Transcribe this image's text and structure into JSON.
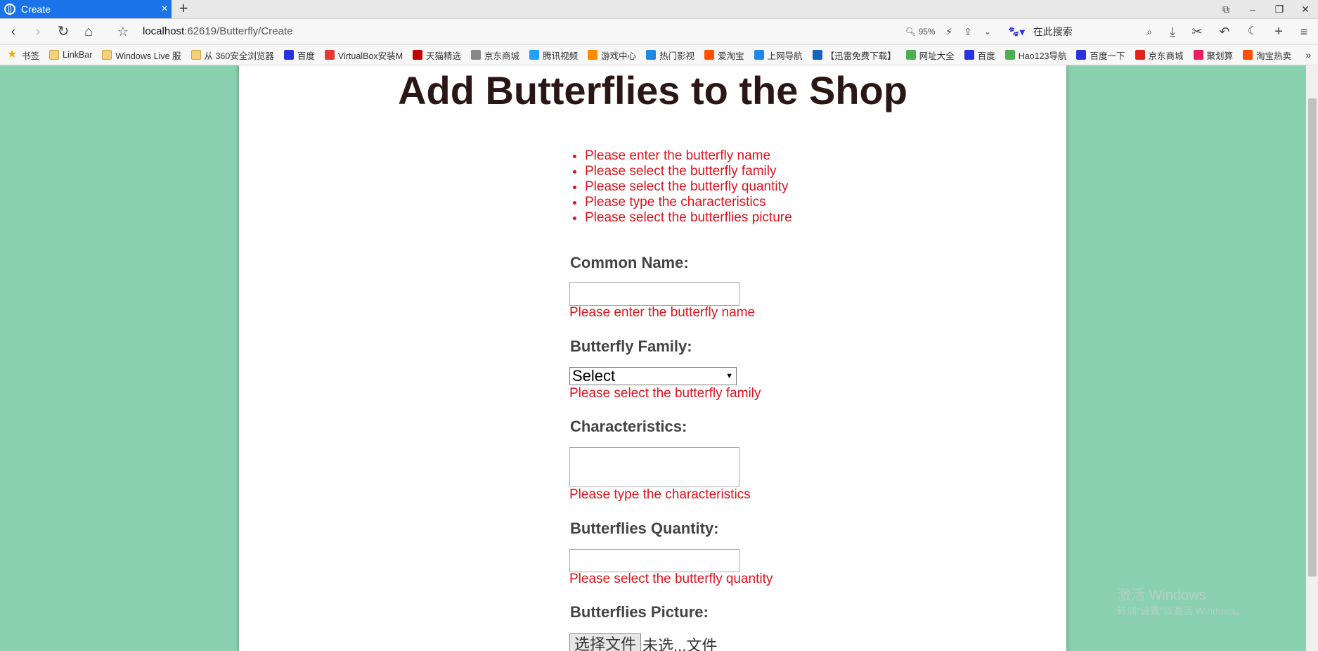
{
  "browser": {
    "tab_title": "Create",
    "url_host": "localhost",
    "url_path": ":62619/Butterfly/Create",
    "zoom": "95%",
    "search_placeholder": "在此搜索"
  },
  "bookmarks": [
    {
      "label": "书签",
      "icon": "star-icon"
    },
    {
      "label": "LinkBar",
      "icon": "folder-icon"
    },
    {
      "label": "Windows Live 服",
      "icon": "folder-icon"
    },
    {
      "label": "从 360安全浏览器",
      "icon": "folder-icon"
    },
    {
      "label": "百度",
      "icon": "baidu-icon"
    },
    {
      "label": "VirtualBox安装M",
      "icon": "c-icon"
    },
    {
      "label": "天猫精选",
      "icon": "tmall-icon"
    },
    {
      "label": "京东商城",
      "icon": "globe-icon"
    },
    {
      "label": "腾讯视频",
      "icon": "tencent-video-icon"
    },
    {
      "label": "游戏中心",
      "icon": "game-icon"
    },
    {
      "label": "热门影视",
      "icon": "video-icon"
    },
    {
      "label": "爱淘宝",
      "icon": "taobao-icon"
    },
    {
      "label": "上网导航",
      "icon": "nav-icon"
    },
    {
      "label": "【迅雷免费下载】",
      "icon": "xunlei-icon"
    },
    {
      "label": "网址大全",
      "icon": "hao-icon"
    },
    {
      "label": "百度",
      "icon": "baidu-icon"
    },
    {
      "label": "Hao123导航",
      "icon": "hao123-icon"
    },
    {
      "label": "百度一下",
      "icon": "baidu-icon"
    },
    {
      "label": "京东商城",
      "icon": "jd-icon"
    },
    {
      "label": "聚划算",
      "icon": "juhuasuan-icon"
    },
    {
      "label": "淘宝热卖",
      "icon": "taobao-icon"
    }
  ],
  "page": {
    "title": "Add Butterflies to the Shop",
    "errors": [
      "Please enter the butterfly name",
      "Please select the butterfly family",
      "Please select the butterfly quantity",
      "Please type the characteristics",
      "Please select the butterflies picture"
    ],
    "common_name": {
      "label": "Common Name:",
      "value": "",
      "error": "Please enter the butterfly name"
    },
    "family": {
      "label": "Butterfly Family:",
      "selected": "Select",
      "error": "Please select the butterfly family"
    },
    "characteristics": {
      "label": "Characteristics:",
      "value": "",
      "error": "Please type the characteristics"
    },
    "quantity": {
      "label": "Butterflies Quantity:",
      "value": "",
      "error": "Please select the butterfly quantity"
    },
    "picture": {
      "label": "Butterflies Picture:",
      "button": "选择文件",
      "status": "未选...文件"
    }
  },
  "watermark": {
    "line1": "激活 Windows",
    "line2": "转到\"设置\"以激活 Windows。"
  },
  "colors": {
    "background": "#8ad1b0",
    "error": "#e0121a",
    "title": "#2b1616",
    "tab": "#1a73e8"
  }
}
